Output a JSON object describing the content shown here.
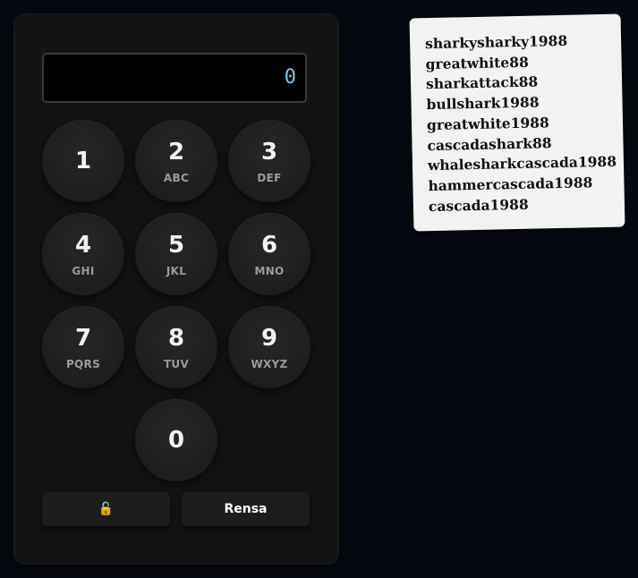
{
  "display": {
    "value": "0"
  },
  "keypad": {
    "keys": [
      {
        "digit": "1",
        "letters": ""
      },
      {
        "digit": "2",
        "letters": "ABC"
      },
      {
        "digit": "3",
        "letters": "DEF"
      },
      {
        "digit": "4",
        "letters": "GHI"
      },
      {
        "digit": "5",
        "letters": "JKL"
      },
      {
        "digit": "6",
        "letters": "MNO"
      },
      {
        "digit": "7",
        "letters": "PQRS"
      },
      {
        "digit": "8",
        "letters": "TUV"
      },
      {
        "digit": "9",
        "letters": "WXYZ"
      },
      {
        "digit": "0",
        "letters": ""
      }
    ]
  },
  "actions": {
    "unlock_label": "🔓",
    "unlock_icon": "unlock-icon",
    "clear_label": "Rensa"
  },
  "note": {
    "lines": [
      "sharkysharky1988",
      "greatwhite88",
      "sharkattack88",
      "bullshark1988",
      "greatwhite1988",
      "cascadashark88",
      "whalesharkcascada1988",
      "hammercascada1988",
      "cascada1988"
    ]
  },
  "colors": {
    "background": "#060a12",
    "panel": "#141414",
    "key": "#1f1f1f",
    "display_text": "#7fc7e6",
    "note_paper": "#f2f2f2"
  }
}
